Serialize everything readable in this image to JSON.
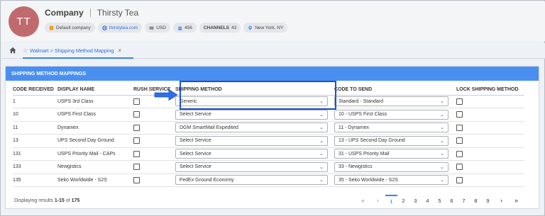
{
  "header": {
    "avatar_initials": "TT",
    "company": "Company",
    "store": "Thirsty Tea",
    "pills": [
      {
        "icon": "tag-icon",
        "text": "Default company"
      },
      {
        "icon": "globe-icon",
        "text": "thirstytea.com"
      },
      {
        "icon": "currency-icon",
        "text": "USD"
      },
      {
        "icon": "users-icon",
        "text": "456"
      },
      {
        "label": "CHANNELS",
        "text": "43"
      },
      {
        "icon": "location-pin-icon",
        "text": "New York, NY"
      }
    ]
  },
  "tabbar": {
    "tab_label": "Walmart > Shipping Method Mapping",
    "close": "×",
    "star": "☆"
  },
  "panel": {
    "title": "SHIPPING METHOD MAPPINGS",
    "columns": [
      "CODE RECEIVED",
      "DISPLAY NAME",
      "RUSH SERVICE",
      "SHIPPING METHOD",
      "CODE TO SEND",
      "LOCK SHIPPING METHOD"
    ],
    "rows": [
      {
        "code": "1",
        "name": "USPS 3rd Class",
        "method": "Generic",
        "send": "Standard - Standard"
      },
      {
        "code": "10",
        "name": "USPS First Class",
        "method": "Select Service",
        "send": "10 - USPS First Class"
      },
      {
        "code": "11",
        "name": "Dynamex",
        "method": "DGM SmartMail Expedited",
        "send": "11 - Dynamex"
      },
      {
        "code": "13",
        "name": "UPS Second Day Ground",
        "method": "Select Service",
        "send": "13 - UPS Second Day Ground"
      },
      {
        "code": "131",
        "name": "USPS Priority Mail - CAPs",
        "method": "Select Service",
        "send": "31 - USPS Priority Mail"
      },
      {
        "code": "133",
        "name": "Newgistics",
        "method": "Select Service",
        "send": "33 - Newgistics"
      },
      {
        "code": "135",
        "name": "Seko Worldwide - S2S",
        "method": "FedEx Ground Economy",
        "send": "35 - Seko Worldwide - S2S"
      }
    ]
  },
  "footer": {
    "prefix": "Displaying results ",
    "range": "1-15",
    "of": " of ",
    "total": "175",
    "pages": [
      "1",
      "2",
      "3",
      "4",
      "5",
      "6",
      "7",
      "8",
      "9"
    ],
    "active_page": "1",
    "nav": {
      "first": "«",
      "prev": "‹",
      "next": "›",
      "last": "»"
    }
  },
  "colors": {
    "accent": "#4a8ff0",
    "avatar": "#c06a6e",
    "highlight": "#1c4fd6",
    "link": "#2f6fd6"
  }
}
